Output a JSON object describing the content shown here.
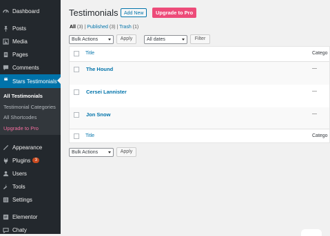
{
  "sidebar": {
    "items": [
      {
        "label": "Dashboard",
        "icon": "dashboard-icon"
      },
      {
        "label": "Posts",
        "icon": "pin-icon"
      },
      {
        "label": "Media",
        "icon": "media-icon"
      },
      {
        "label": "Pages",
        "icon": "pages-icon"
      },
      {
        "label": "Comments",
        "icon": "comment-icon"
      },
      {
        "label": "Stars Testimonials",
        "icon": "quote-icon"
      },
      {
        "label": "Appearance",
        "icon": "brush-icon"
      },
      {
        "label": "Plugins",
        "icon": "plugin-icon",
        "badge": "3"
      },
      {
        "label": "Users",
        "icon": "user-icon"
      },
      {
        "label": "Tools",
        "icon": "wrench-icon"
      },
      {
        "label": "Settings",
        "icon": "settings-icon"
      },
      {
        "label": "Elementor",
        "icon": "elementor-icon"
      },
      {
        "label": "Chaty",
        "icon": "chat-icon"
      }
    ],
    "submenu": [
      "All Testimonials",
      "Testimonial Categories",
      "All Shortcodes",
      "Upgrade to Pro"
    ]
  },
  "header": {
    "title": "Testimonials",
    "add_new": "Add New",
    "upgrade": "Upgrade to Pro"
  },
  "views": {
    "all": "All",
    "all_count": "(3)",
    "published": "Published",
    "published_count": "(3)",
    "trash": "Trash",
    "trash_count": "(1)"
  },
  "filters": {
    "bulk_actions": "Bulk Actions",
    "apply": "Apply",
    "dates": "All dates",
    "filter": "Filter"
  },
  "table": {
    "col_title": "Title",
    "col_category": "Catego",
    "rows": [
      {
        "title": "The Hound",
        "category": "—"
      },
      {
        "title": "Cersei Lannister",
        "category": "—"
      },
      {
        "title": "Jon Snow",
        "category": "—"
      }
    ]
  },
  "colors": {
    "accent": "#0073aa",
    "pink": "#ed4b79",
    "sidebar": "#23282d"
  }
}
